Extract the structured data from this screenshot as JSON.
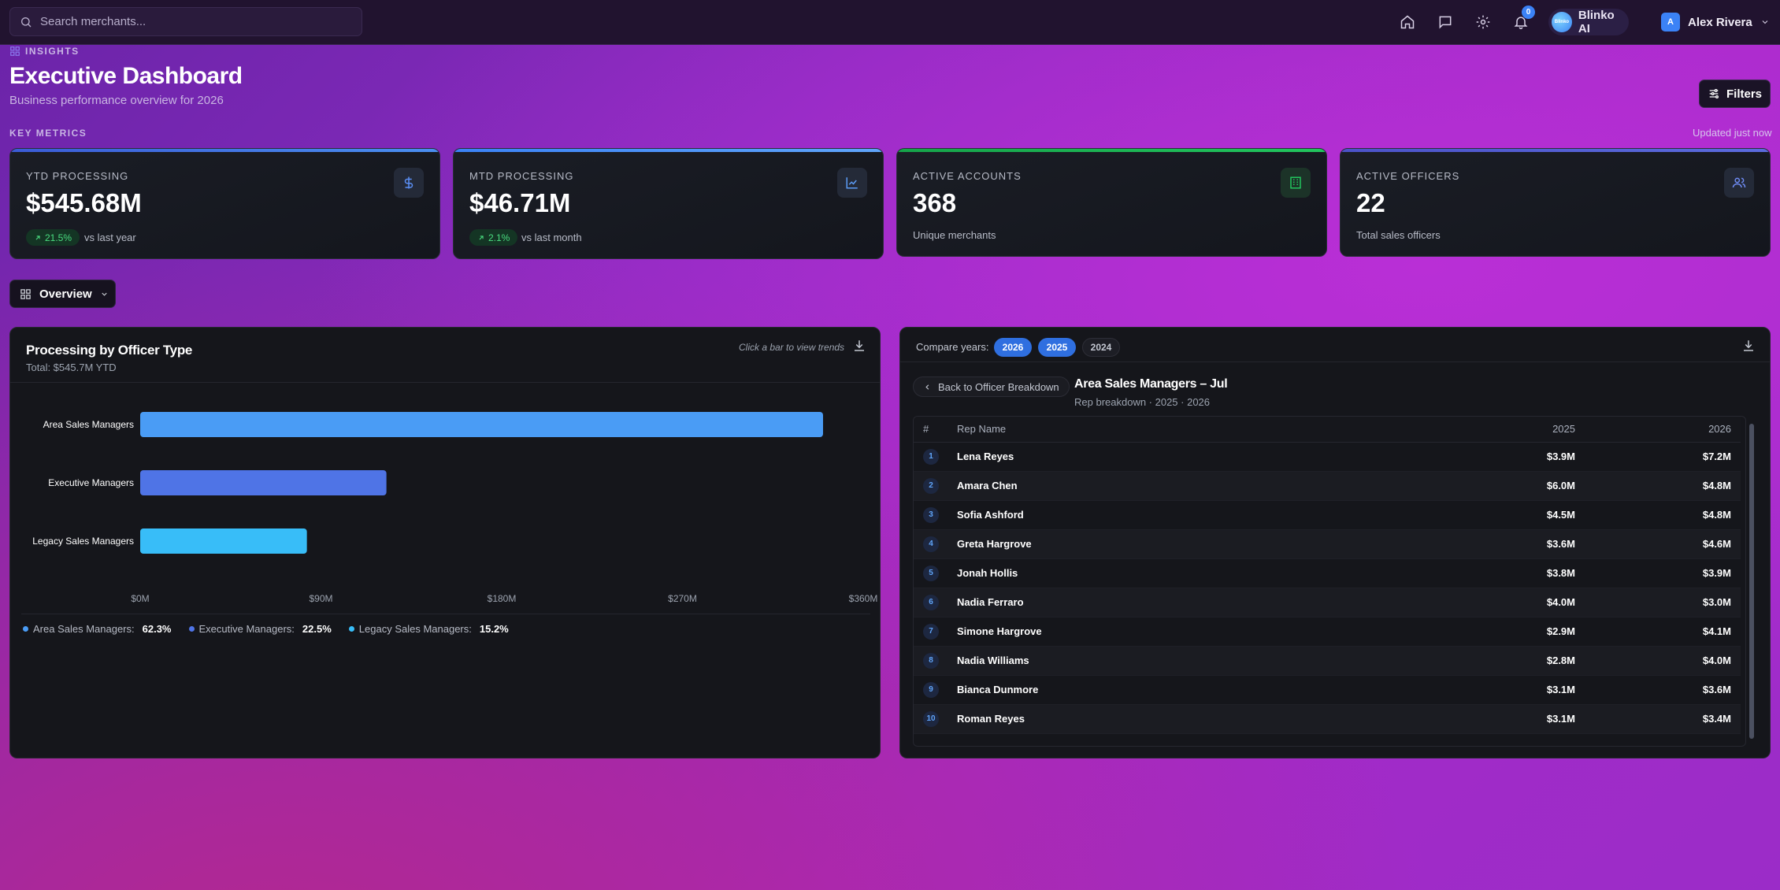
{
  "topbar": {
    "search_placeholder": "Search merchants...",
    "notification_count": "0",
    "assistant_label": "Blinko AI",
    "assistant_logo_text": "Blinko",
    "user_initial": "A",
    "user_name": "Alex Rivera"
  },
  "header": {
    "section_tag": "INSIGHTS",
    "title": "Executive Dashboard",
    "subtitle": "Business performance overview for 2026",
    "filters_label": "Filters",
    "key_metrics_label": "KEY METRICS",
    "updated_label": "Updated just now"
  },
  "metrics": [
    {
      "label": "YTD PROCESSING",
      "value": "$545.68M",
      "change": "21.5%",
      "compare": "vs last year",
      "accent": "#3b6fe0"
    },
    {
      "label": "MTD PROCESSING",
      "value": "$46.71M",
      "change": "2.1%",
      "compare": "vs last month",
      "accent": "#3b82f6"
    },
    {
      "label": "ACTIVE ACCOUNTS",
      "value": "368",
      "sub": "Unique merchants",
      "accent": "#22c55e"
    },
    {
      "label": "ACTIVE OFFICERS",
      "value": "22",
      "sub": "Total sales officers",
      "accent": "#4f5fd0"
    }
  ],
  "view_selector": {
    "label": "Overview"
  },
  "left_panel": {
    "title": "Processing by Officer Type",
    "subtitle": "Total: $545.7M YTD",
    "hint": "Click a bar to view trends",
    "legend": [
      {
        "name": "Area Sales Managers:",
        "value": "62.3%",
        "color": "#4a9cf5"
      },
      {
        "name": "Executive Managers:",
        "value": "22.5%",
        "color": "#4f74e6"
      },
      {
        "name": "Legacy Sales Managers:",
        "value": "15.2%",
        "color": "#38bdf8"
      }
    ]
  },
  "chart_data": {
    "type": "bar",
    "orientation": "horizontal",
    "categories": [
      "Area Sales Managers",
      "Executive Managers",
      "Legacy Sales Managers"
    ],
    "values": [
      340.0,
      122.6,
      83.0
    ],
    "colors": [
      "#4a9cf5",
      "#4f74e6",
      "#38bdf8"
    ],
    "xlim": [
      0,
      360
    ],
    "xticks": [
      0,
      90,
      180,
      270,
      360
    ],
    "xtick_labels": [
      "$0M",
      "$90M",
      "$180M",
      "$270M",
      "$360M"
    ],
    "grid": false
  },
  "right_panel": {
    "compare_label": "Compare years:",
    "years": [
      {
        "label": "2026",
        "active": true
      },
      {
        "label": "2025",
        "active": true
      },
      {
        "label": "2024",
        "active": false
      }
    ],
    "back_label": "Back to Officer Breakdown",
    "title": "Area Sales Managers – Jul",
    "subtitle": "Rep breakdown · 2025 · 2026",
    "columns": [
      "#",
      "Rep Name",
      "2025",
      "2026"
    ],
    "rows": [
      {
        "rank": "1",
        "name": "Lena Reyes",
        "y2025": "$3.9M",
        "y2026": "$7.2M"
      },
      {
        "rank": "2",
        "name": "Amara Chen",
        "y2025": "$6.0M",
        "y2026": "$4.8M"
      },
      {
        "rank": "3",
        "name": "Sofia Ashford",
        "y2025": "$4.5M",
        "y2026": "$4.8M"
      },
      {
        "rank": "4",
        "name": "Greta Hargrove",
        "y2025": "$3.6M",
        "y2026": "$4.6M"
      },
      {
        "rank": "5",
        "name": "Jonah Hollis",
        "y2025": "$3.8M",
        "y2026": "$3.9M"
      },
      {
        "rank": "6",
        "name": "Nadia Ferraro",
        "y2025": "$4.0M",
        "y2026": "$3.0M"
      },
      {
        "rank": "7",
        "name": "Simone Hargrove",
        "y2025": "$2.9M",
        "y2026": "$4.1M"
      },
      {
        "rank": "8",
        "name": "Nadia Williams",
        "y2025": "$2.8M",
        "y2026": "$4.0M"
      },
      {
        "rank": "9",
        "name": "Bianca Dunmore",
        "y2025": "$3.1M",
        "y2026": "$3.6M"
      },
      {
        "rank": "10",
        "name": "Roman Reyes",
        "y2025": "$3.1M",
        "y2026": "$3.4M"
      }
    ]
  }
}
